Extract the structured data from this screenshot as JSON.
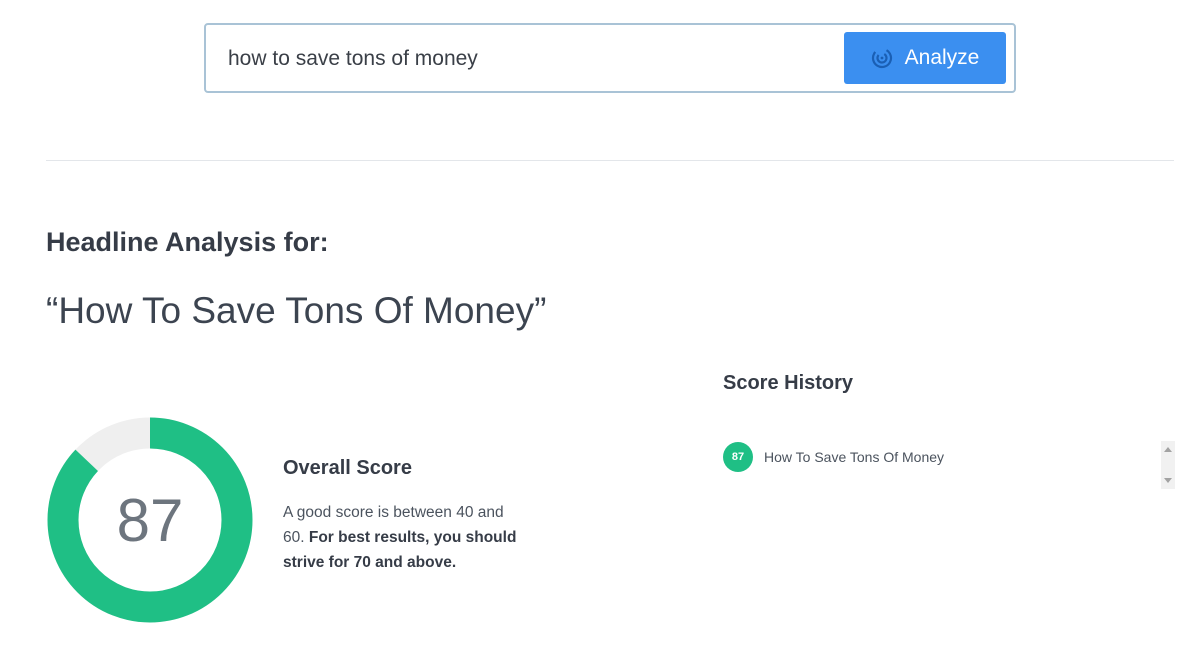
{
  "search": {
    "value": "how to save tons of money",
    "button_label": "Analyze",
    "button_icon": "target-icon"
  },
  "analysis": {
    "heading": "Headline Analysis for:",
    "headline": "How To Save Tons Of Money",
    "quote_open": "“",
    "quote_close": "”"
  },
  "score": {
    "value": "87",
    "fraction": 0.87,
    "title": "Overall Score",
    "desc_plain": "A good score is between 40 and 60. ",
    "desc_bold": "For best results, you should strive for 70 and above."
  },
  "history": {
    "title": "Score History",
    "items": [
      {
        "score": "87",
        "headline": "How To Save Tons Of Money"
      }
    ]
  },
  "colors": {
    "accent_green": "#1fbf85",
    "button_blue": "#3b8ff0",
    "gauge_track": "#efefef"
  }
}
